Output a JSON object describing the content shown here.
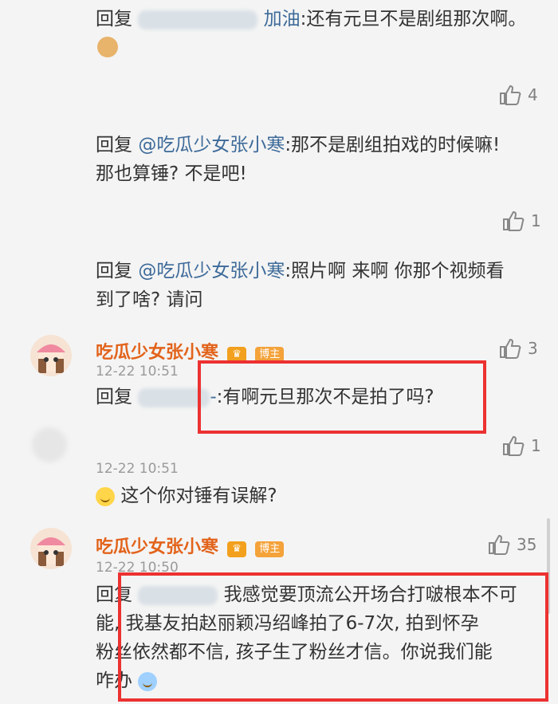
{
  "comments": [
    {
      "reply_prefix": "回复",
      "mention_suffix": "加油",
      "text": ":还有元旦不是剧组那次啊。",
      "emoji": "doge-emoji",
      "likes": "4"
    },
    {
      "reply_prefix": "回复",
      "mention": "@吃瓜少女张小寒",
      "text_line1": ":那不是剧组拍戏的时候嘛!",
      "text_line2": "那也算锤? 不是吧!",
      "likes": "1"
    },
    {
      "reply_prefix": "回复",
      "mention": "@吃瓜少女张小寒",
      "text_line1": ":照片啊 来啊 你那个视频看",
      "text_line2": "到了啥? 请问"
    },
    {
      "author": "吃瓜少女张小寒",
      "badge": "博主",
      "likes": "3",
      "time": "12-22 10:51",
      "reply_prefix": "回复",
      "mention_suffix": "-",
      "text": ":有啊元旦那次不是拍了吗?"
    },
    {
      "likes": "1",
      "time": "12-22 10:51",
      "text": "这个你对锤有误解?"
    },
    {
      "author": "吃瓜少女张小寒",
      "badge": "博主",
      "likes": "35",
      "time": "12-22 10:50",
      "reply_prefix": "回复",
      "line1": "我感觉要顶流公开场合打啵根本不可",
      "line2": "能, 我基友拍赵丽颖冯绍峰拍了6-7次, 拍到怀孕",
      "line3": "粉丝依然都不信, 孩子生了粉丝才信。你说我们能",
      "line4": "咋办"
    }
  ],
  "colors": {
    "link": "#3d6a99",
    "author": "#e2631b",
    "highlight_box": "#ec3131",
    "background": "#f4f4f4"
  }
}
